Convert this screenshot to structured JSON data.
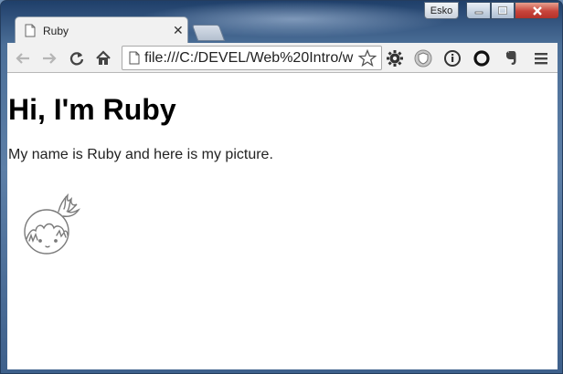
{
  "window": {
    "profile_name": "Esko",
    "controls": [
      "minimize-icon",
      "maximize-icon",
      "close-icon"
    ]
  },
  "tabs": [
    {
      "title": "Ruby",
      "icon": "page-icon",
      "active": true
    }
  ],
  "toolbar": {
    "url": "file:///C:/DEVEL/Web%20Intro/w",
    "buttons": [
      "back-icon",
      "forward-icon",
      "reload-icon",
      "home-icon"
    ],
    "extensions": [
      "gear-icon",
      "shield-icon",
      "info-icon",
      "circle-icon",
      "evernote-icon",
      "menu-icon"
    ]
  },
  "page": {
    "heading": "Hi, I'm Ruby",
    "paragraph": "My name is Ruby and here is my picture.",
    "picture_icon": "ruby-avatar"
  }
}
